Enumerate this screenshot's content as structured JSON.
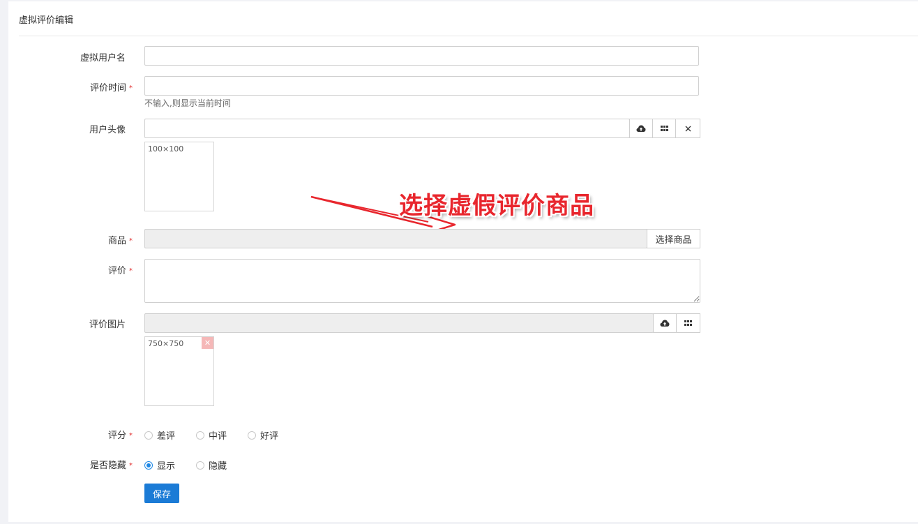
{
  "header": {
    "title": "虚拟评价编辑"
  },
  "fields": {
    "username": {
      "label": "虚拟用户名",
      "value": ""
    },
    "time": {
      "label": "评价时间",
      "value": "",
      "hint": "不输入,则显示当前时间"
    },
    "avatar": {
      "label": "用户头像",
      "value": "",
      "thumb_size": "100×100"
    },
    "product": {
      "label": "商品",
      "value": "",
      "button": "选择商品"
    },
    "review": {
      "label": "评价",
      "value": ""
    },
    "images": {
      "label": "评价图片",
      "value": "",
      "thumb_size": "750×750"
    },
    "rating": {
      "label": "评分",
      "options": [
        "差评",
        "中评",
        "好评"
      ],
      "selected": null
    },
    "hidden": {
      "label": "是否隐藏",
      "options": [
        "显示",
        "隐藏"
      ],
      "selected": "显示"
    }
  },
  "required_marker": "*",
  "actions": {
    "save": "保存"
  },
  "annotation": {
    "text": "选择虚假评价商品",
    "color": "#e8262d"
  },
  "colors": {
    "primary": "#1b7bd6",
    "required": "#e02b2b"
  }
}
